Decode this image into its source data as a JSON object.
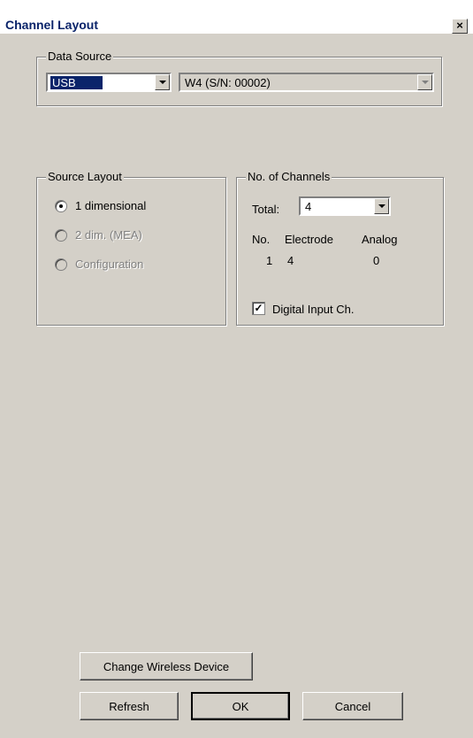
{
  "window": {
    "title": "Channel Layout",
    "close_label": "×"
  },
  "data_source": {
    "legend": "Data Source",
    "interface": "USB",
    "device": "W4 (S/N: 00002)"
  },
  "source_layout": {
    "legend": "Source Layout",
    "options": [
      "1 dimensional",
      "2 dim. (MEA)",
      "Configuration"
    ],
    "selected": "1 dimensional"
  },
  "channels": {
    "legend": "No. of Channels",
    "total_label": "Total:",
    "total_value": "4",
    "headers": [
      "No.",
      "Electrode",
      "Analog"
    ],
    "row": [
      "1",
      "4",
      "0"
    ],
    "digital_input_label": "Digital Input Ch.",
    "digital_input_checked": true
  },
  "buttons": {
    "change_wireless": "Change Wireless Device",
    "refresh": "Refresh",
    "ok": "OK",
    "cancel": "Cancel"
  }
}
